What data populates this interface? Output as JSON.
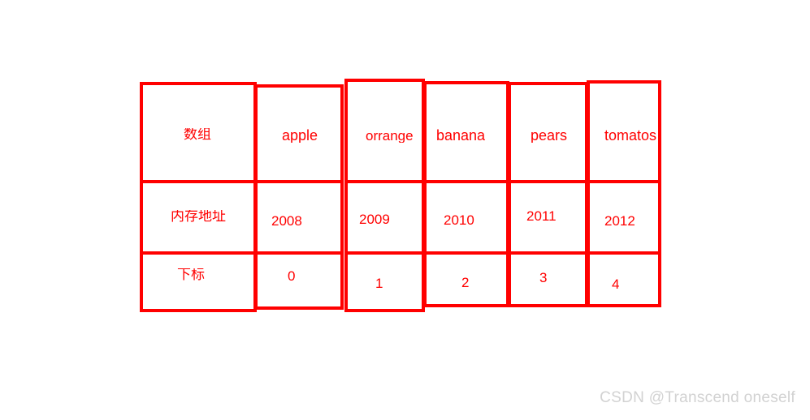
{
  "diagram": {
    "title": "array-index-memory-table",
    "accent_color": "#ff0000",
    "rows": [
      {
        "label": "数组",
        "cells": [
          "apple",
          "orrange",
          "banana",
          "pears",
          "tomatos"
        ]
      },
      {
        "label": "内存地址",
        "cells": [
          "2008",
          "2009",
          "2010",
          "2011",
          "2012"
        ]
      },
      {
        "label": "下标",
        "cells": [
          "0",
          "1",
          "2",
          "3",
          "4"
        ]
      }
    ]
  },
  "watermark": {
    "text": "CSDN @Transcend oneself",
    "color": "#d2d2d2"
  }
}
